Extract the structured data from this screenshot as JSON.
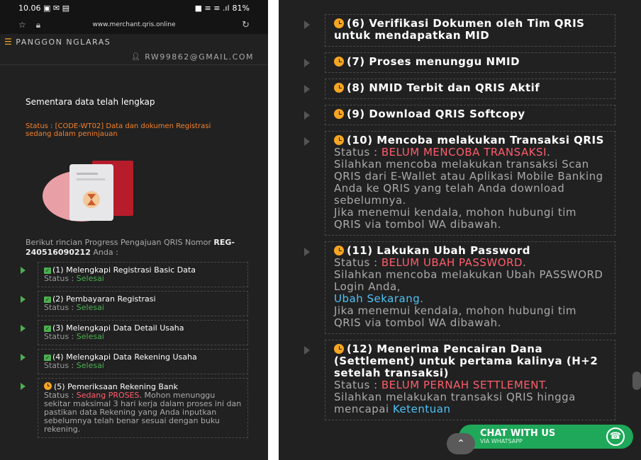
{
  "left": {
    "statusbar": {
      "time": "10.06",
      "icons": "▣ ✉ ▤",
      "right": "■ ≡ ≡ .ıl",
      "battery": "81%"
    },
    "browser": {
      "url": "www.merchant.qris.online"
    },
    "brand": "PANGGON NGLARAS",
    "email": "RW99862@GMAIL.COM",
    "summary": "Sementara data telah lengkap",
    "status_label": "Status : ",
    "status_value": "[CODE-WT02] Data dan dokumen Registrasi sedang dalam peninjauan",
    "intro_pre": "Berikut rincian Progress Pengajuan QRIS Nomor ",
    "intro_number": "REG-240516090212",
    "intro_post": " Anda :",
    "steps": [
      {
        "title": "(1) Melengkapi Registrasi Basic Data",
        "status_label": "Status : ",
        "status": "Selesai"
      },
      {
        "title": "(2) Pembayaran Registrasi",
        "status_label": "Status : ",
        "status": "Selesai"
      },
      {
        "title": "(3) Melengkapi Data Detail Usaha",
        "status_label": "Status : ",
        "status": "Selesai"
      },
      {
        "title": "(4) Melengkapi Data Rekening Usaha",
        "status_label": "Status : ",
        "status": "Selesai"
      },
      {
        "title": "(5) Pemeriksaan Rekening Bank",
        "status_label": "Status : ",
        "status": "Sedang PROSES",
        "desc": ". Mohon menunggu sekitar maksimal 3 hari kerja dalam proses ini dan pastikan data Rekening yang Anda inputkan sebelumnya telah benar sesuai dengan buku rekening."
      }
    ]
  },
  "right": {
    "steps": [
      {
        "title": "(6) Verifikasi Dokumen oleh Tim QRIS untuk mendapatkan MID"
      },
      {
        "title": "(7) Proses menunggu NMID"
      },
      {
        "title": "(8) NMID Terbit dan QRIS Aktif"
      },
      {
        "title": "(9) Download QRIS Softcopy"
      },
      {
        "title": "(10) Mencoba melakukan Transaksi QRIS",
        "status_label": "Status : ",
        "status": "BELUM MENCOBA TRANSAKSI",
        "desc": "Silahkan mencoba melakukan transaksi Scan QRIS dari E-Wallet atau Aplikasi Mobile Banking Anda ke QRIS yang telah Anda download sebelumnya.",
        "desc2": "Jika menemui kendala, mohon hubungi tim QRIS via tombol WA dibawah."
      },
      {
        "title": "(11) Lakukan Ubah Password",
        "status_label": "Status : ",
        "status": "BELUM UBAH PASSWORD",
        "desc": "Silahkan mencoba melakukan Ubah PASSWORD Login Anda,",
        "link": "Ubah Sekarang",
        "desc2": "Jika menemui kendala, mohon hubungi tim QRIS via tombol WA dibawah."
      },
      {
        "title": "(12) Menerima Pencairan Dana (Settlement) untuk pertama kalinya (H+2 setelah transaksi)",
        "status_label": "Status : ",
        "status": "BELUM PERNAH SETTLEMENT",
        "desc": "Silahkan melakukan transaksi QRIS hingga mencapai",
        "link": "Ketentuan"
      }
    ],
    "wa_button": {
      "label": "CHAT WITH US",
      "sub": "VIA WHATSAPP"
    },
    "up_button": "⌃",
    "whatsapp_icon": "☎"
  }
}
